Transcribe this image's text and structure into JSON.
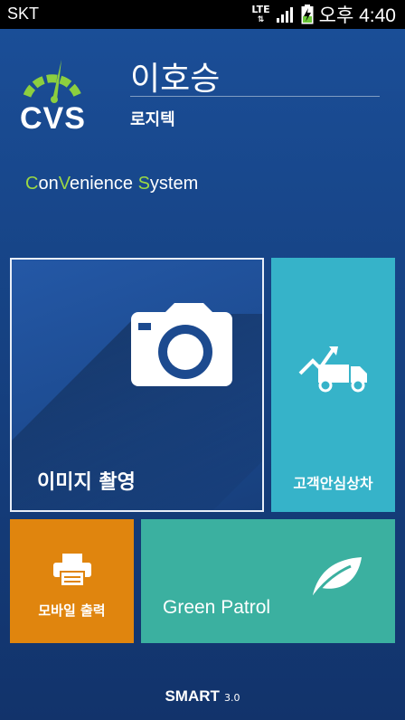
{
  "status_bar": {
    "carrier": "SKT",
    "network": "LTE",
    "time": "오후 4:40"
  },
  "header": {
    "logo_text": "CVS",
    "user_name": "이호승",
    "company": "로지텍"
  },
  "tagline": {
    "c1": "C",
    "t1": "on",
    "c2": "V",
    "t2": "enience ",
    "c3": "S",
    "t3": "ystem"
  },
  "tiles": {
    "image_capture": {
      "label": "이미지 촬영",
      "icon": "camera-icon",
      "color": "#1c4a8f"
    },
    "safe_car": {
      "label": "고객안심상차",
      "icon": "truck-icon",
      "color": "#36b3c9"
    },
    "mobile_print": {
      "label": "모바일 출력",
      "icon": "printer-icon",
      "color": "#e0850e"
    },
    "green_patrol": {
      "label": "Green Patrol",
      "icon": "leaf-icon",
      "color": "#3bb0a0"
    }
  },
  "footer": {
    "brand": "SMART",
    "version": "3.0"
  },
  "colors": {
    "accent_green": "#9bd844",
    "background": "#164283"
  }
}
